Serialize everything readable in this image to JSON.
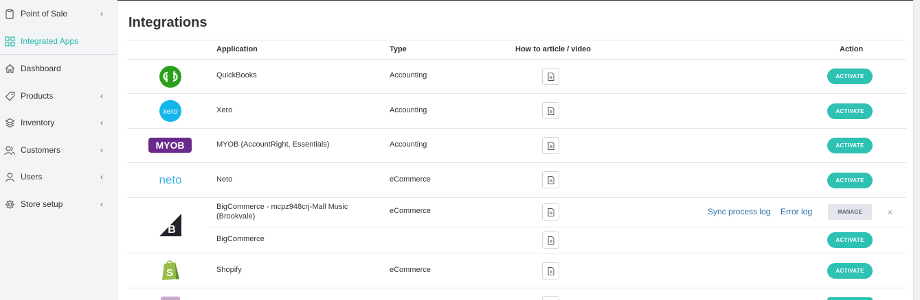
{
  "sidebar": {
    "items": [
      {
        "label": "Point of Sale",
        "icon": "clipboard-icon",
        "has_chevron": true
      },
      {
        "label": "Integrated Apps",
        "icon": "grid-icon",
        "has_chevron": false,
        "active": true
      },
      {
        "label": "Dashboard",
        "icon": "home-icon",
        "has_chevron": false
      },
      {
        "label": "Products",
        "icon": "tag-icon",
        "has_chevron": true
      },
      {
        "label": "Inventory",
        "icon": "layers-icon",
        "has_chevron": true
      },
      {
        "label": "Customers",
        "icon": "users-icon",
        "has_chevron": true
      },
      {
        "label": "Users",
        "icon": "user-icon",
        "has_chevron": true
      },
      {
        "label": "Store setup",
        "icon": "gear-icon",
        "has_chevron": true
      }
    ],
    "chevron": "‹"
  },
  "main": {
    "title": "Integrations",
    "columns": {
      "application": "Application",
      "type": "Type",
      "howto": "How to article / video",
      "action": "Action"
    },
    "rows": [
      {
        "logo": "quickbooks-logo",
        "app": "QuickBooks",
        "type": "Accounting",
        "action": "ACTIVATE"
      },
      {
        "logo": "xero-logo",
        "app": "Xero",
        "type": "Accounting",
        "action": "ACTIVATE"
      },
      {
        "logo": "myob-logo",
        "app": "MYOB (AccountRight, Essentials)",
        "type": "Accounting",
        "action": "ACTIVATE"
      },
      {
        "logo": "neto-logo",
        "app": "Neto",
        "type": "eCommerce",
        "action": "ACTIVATE"
      },
      {
        "logo": "bigcommerce-logo",
        "app": "BigCommerce - mcpz948crj-Mall Music (Brookvale)",
        "type": "eCommerce",
        "sync_link": "Sync process log",
        "error_link": "Error log",
        "action": "MANAGE",
        "remove": "×"
      },
      {
        "logo": "bigcommerce-logo",
        "app": "BigCommerce",
        "type": "",
        "action": "ACTIVATE"
      },
      {
        "logo": "shopify-logo",
        "app": "Shopify",
        "type": "eCommerce",
        "action": "ACTIVATE"
      }
    ],
    "logo_text": {
      "xero": "xero",
      "myob": "MYOB",
      "neto": "neto"
    }
  },
  "colors": {
    "accent": "#2ec1b4",
    "link": "#2f6da3",
    "sidebar_bg": "#f2f4f6",
    "quickbooks": "#2ca01c",
    "xero": "#13b5ea",
    "myob": "#6a2a8c",
    "shopify": "#95bf47"
  }
}
